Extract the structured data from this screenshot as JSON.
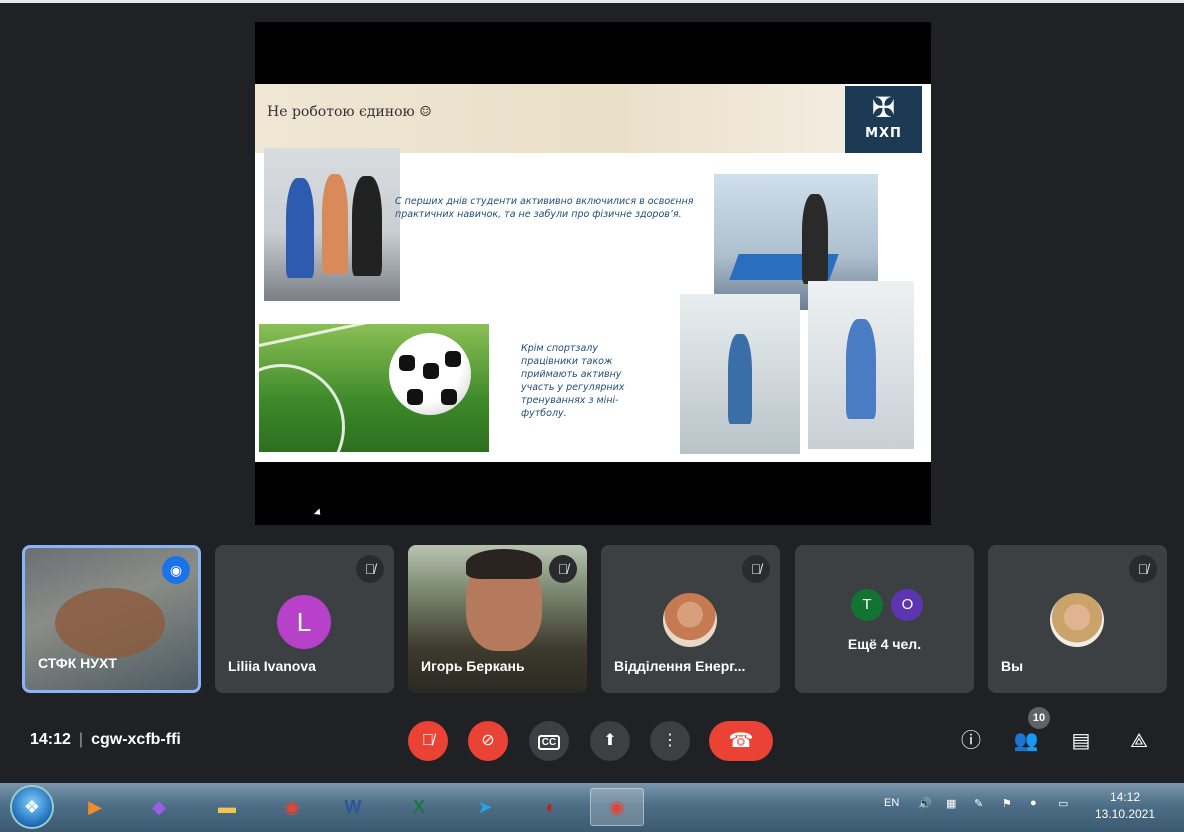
{
  "presentation": {
    "title": "Не роботою єдиною ☺",
    "logo_text": "МХП",
    "paragraph_1": "С перших днів студенти актививно включилися в освоєння практичних навичок, та не забули про фізичне здоров’я.",
    "paragraph_2": "Крім спортзалу працівники також приймають активну участь у регулярних тренуваннях з міні-футболу."
  },
  "participants": [
    {
      "name": "СТФК НУХТ",
      "speaking": true
    },
    {
      "name": "Liliia Ivanova",
      "initial": "L",
      "muted": true
    },
    {
      "name": "Игорь Беркань",
      "muted": true
    },
    {
      "name": "Відділення Енерг...",
      "muted": true
    },
    {
      "name": "Ещё 4 чел.",
      "chips": [
        "T",
        "O"
      ]
    },
    {
      "name": "Вы",
      "muted": true
    }
  ],
  "meeting": {
    "time": "14:12",
    "separator": "|",
    "code": "cgw-xcfb-ffi",
    "people_count": "10"
  },
  "controls": {
    "mic_icon": "mic-off-icon",
    "camera_icon": "camera-off-icon",
    "captions_label": "CC",
    "present_icon": "present-screen-icon",
    "more_icon": "more-vertical-icon",
    "hangup_icon": "hangup-icon"
  },
  "taskbar": {
    "lang": "EN",
    "clock_time": "14:12",
    "clock_date": "13.10.2021"
  },
  "colors": {
    "accent": "#8ab4f8",
    "danger": "#ea4335",
    "tile_bg": "#3c4043",
    "bg": "#202124"
  }
}
